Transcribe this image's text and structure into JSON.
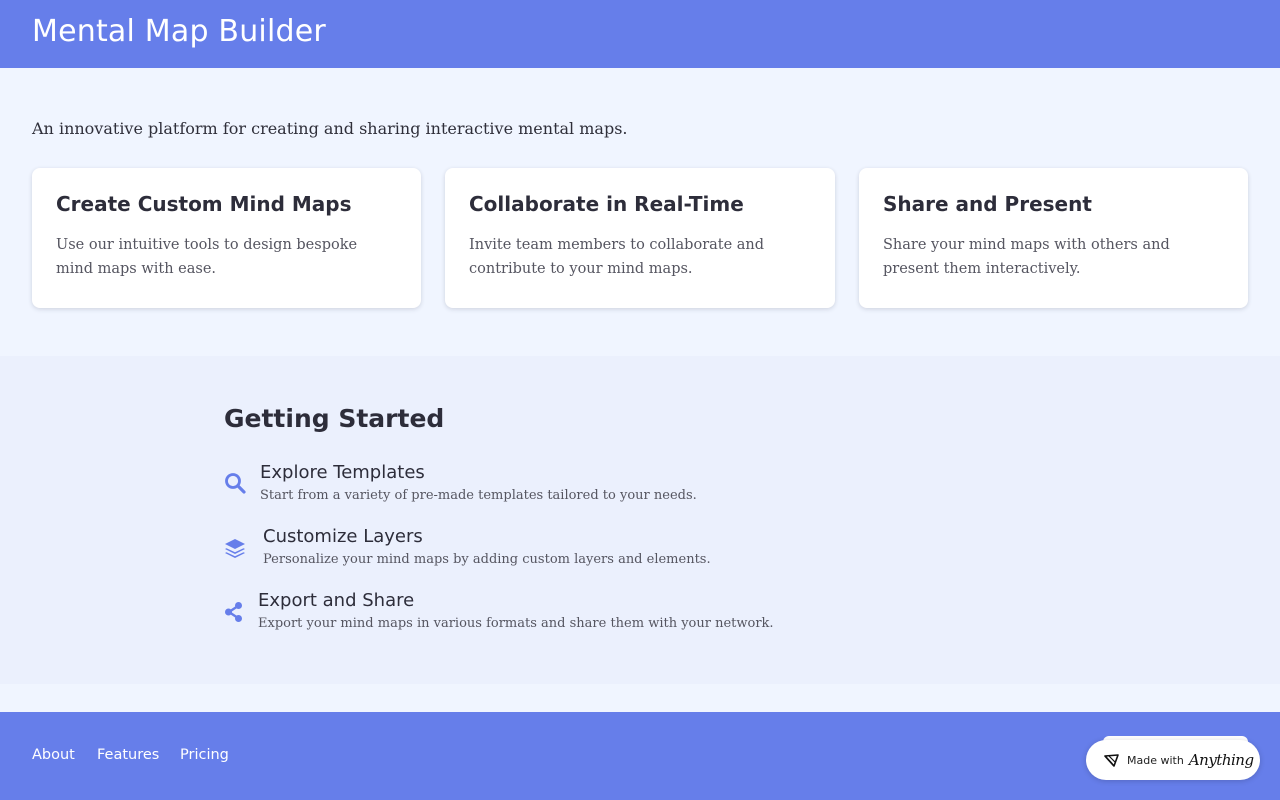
{
  "app": {
    "title": "Mental Map Builder"
  },
  "hero": {
    "tagline": "An innovative platform for creating and sharing interactive mental maps."
  },
  "features": [
    {
      "title": "Create Custom Mind Maps",
      "description": "Use our intuitive tools to design bespoke mind maps with ease."
    },
    {
      "title": "Collaborate in Real-Time",
      "description": "Invite team members to collaborate and contribute to your mind maps."
    },
    {
      "title": "Share and Present",
      "description": "Share your mind maps with others and present them interactively."
    }
  ],
  "getting_started": {
    "title": "Getting Started",
    "steps": [
      {
        "icon": "search-icon",
        "title": "Explore Templates",
        "description": "Start from a variety of pre-made templates tailored to your needs."
      },
      {
        "icon": "layers-icon",
        "title": "Customize Layers",
        "description": "Personalize your mind maps by adding custom layers and elements."
      },
      {
        "icon": "share-icon",
        "title": "Export and Share",
        "description": "Export your mind maps in various formats and share them with your network."
      }
    ]
  },
  "footer": {
    "links": [
      {
        "label": "About"
      },
      {
        "label": "Features"
      },
      {
        "label": "Pricing"
      }
    ]
  },
  "badge": {
    "prefix": "Made with",
    "brand": "Anything"
  },
  "colors": {
    "accent": "#667eea",
    "page_background": "#f0f5ff",
    "section_background": "#ebf0fd",
    "card_background": "#ffffff",
    "text_primary": "#2d2d3a",
    "text_secondary": "#555560"
  }
}
